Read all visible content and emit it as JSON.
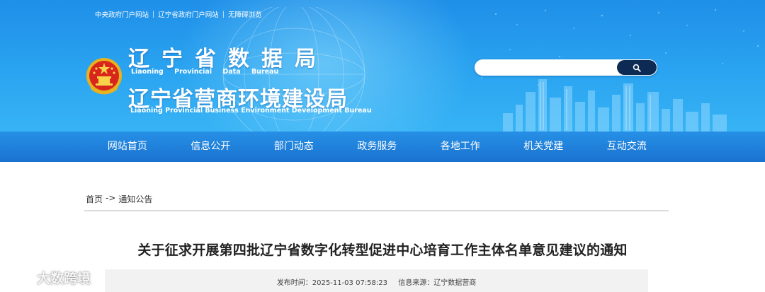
{
  "top_links": [
    "中央政府门户网站",
    "辽宁省政府门户网站",
    "无障碍浏览"
  ],
  "title": {
    "zh_line1": "辽宁省数据局",
    "en_line1": "Liaoning Provincial Data Bureau",
    "zh_line2": "辽宁省营商环境建设局",
    "en_line2": "Liaoning Provincial Business Environment Development Bureau"
  },
  "search": {
    "placeholder": "",
    "icon": "search-icon"
  },
  "nav": {
    "items": [
      {
        "label": "网站首页"
      },
      {
        "label": "信息公开"
      },
      {
        "label": "部门动态"
      },
      {
        "label": "政务服务"
      },
      {
        "label": "各地工作"
      },
      {
        "label": "机关党建"
      },
      {
        "label": "互动交流"
      }
    ]
  },
  "breadcrumb": {
    "home": "首页",
    "separator": "->",
    "current": "通知公告"
  },
  "article": {
    "title": "关于征求开展第四批辽宁省数字化转型促进中心培育工作主体名单意见建议的通知",
    "publish_time": "发布时间：2025-11-03 07:58:23",
    "source": "信息来源：辽宁数据营商"
  },
  "watermark": {
    "text": "大数跨境"
  },
  "colors": {
    "banner": "#2aa4f0",
    "nav": "#1f80db",
    "search_button": "#0d2a55"
  }
}
